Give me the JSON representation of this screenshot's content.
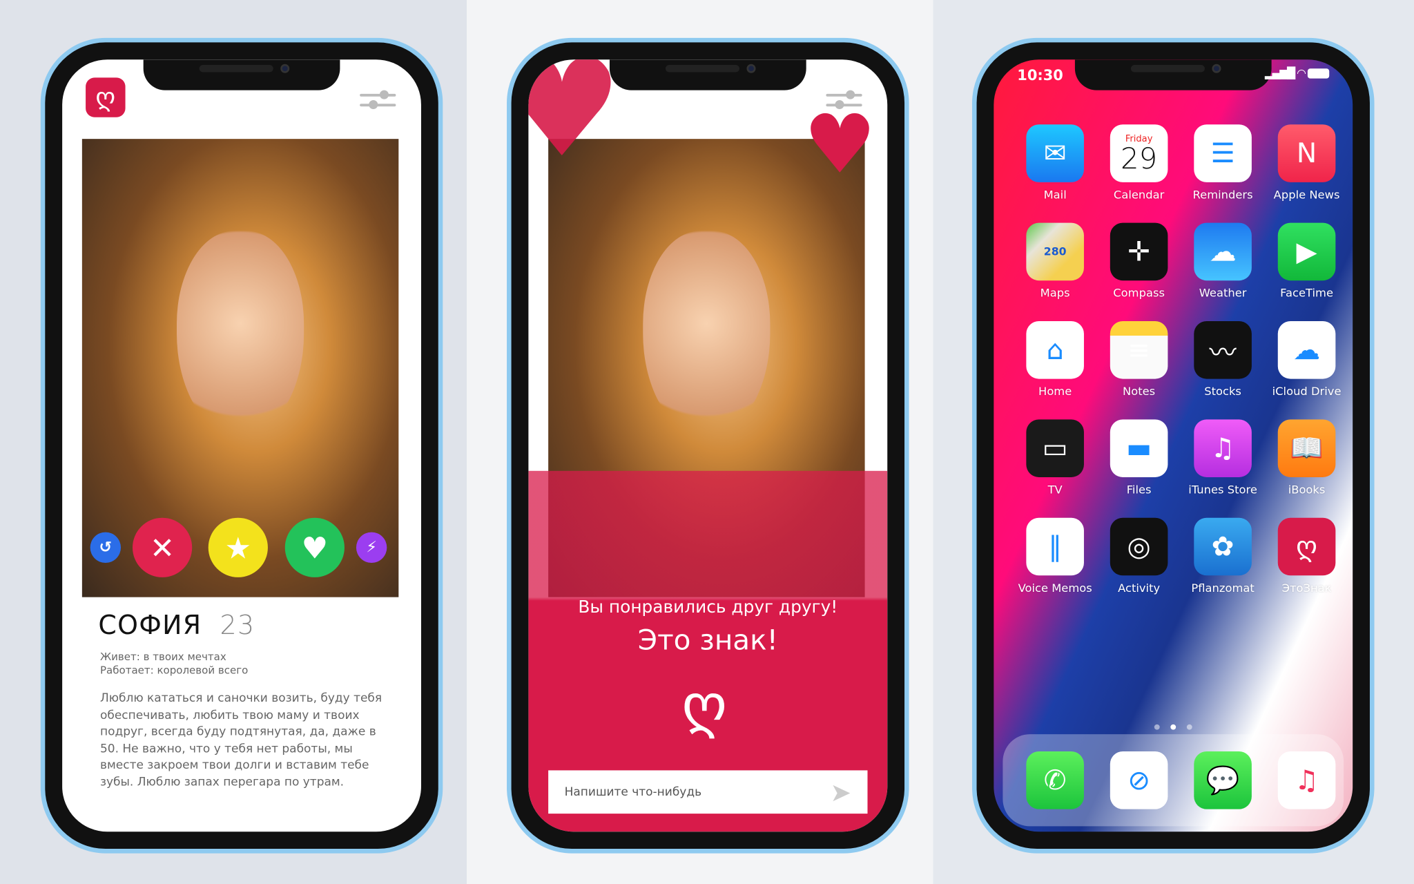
{
  "profile_screen": {
    "logo_icon": "heart-logo-icon",
    "filter_icon": "sliders-icon",
    "name": "СОФИЯ",
    "age": "23",
    "lives": "Живет: в твоих мечтах",
    "works": "Работает: королевой всего",
    "bio": "Люблю кататься и саночки возить, буду тебя обеспечивать, любить твою маму и твоих подруг, всегда буду подтянутая, да, даже в 50. Не важно, что у тебя нет работы, мы вместе закроем твои долги и вставим тебе зубы. Люблю запах перегара по утрам.",
    "actions": [
      {
        "icon": "rewind-icon",
        "glyph": "↺",
        "color": "#2b6de8"
      },
      {
        "icon": "close-icon",
        "glyph": "✕",
        "color": "#e0234e"
      },
      {
        "icon": "star-icon",
        "glyph": "★",
        "color": "#f3e21c"
      },
      {
        "icon": "heart-icon",
        "glyph": "♥",
        "color": "#23c25a"
      },
      {
        "icon": "boost-icon",
        "glyph": "⚡",
        "color": "#9b3ef0"
      }
    ]
  },
  "match_screen": {
    "title": "Вы понравились друг другу!",
    "subtitle": "Это знак!",
    "message_placeholder": "Напишите что-нибудь",
    "accent": "#d81b4a"
  },
  "home_screen": {
    "time": "10:30",
    "signal": "▂▄▆█",
    "calendar_day": "Friday",
    "calendar_date": "29",
    "apps": [
      {
        "label": "Mail",
        "glyph": "✉",
        "bg": "linear-gradient(#1ec8ff,#1a78f0)"
      },
      {
        "label": "Calendar",
        "glyph": "",
        "bg": "#ffffff"
      },
      {
        "label": "Reminders",
        "glyph": "☰",
        "bg": "#ffffff"
      },
      {
        "label": "Apple News",
        "glyph": "N",
        "bg": "linear-gradient(#ff5b6b,#f0244a)"
      },
      {
        "label": "Maps",
        "glyph": "280",
        "bg": "linear-gradient(135deg,#5cc84a 0,#e8e4d8 30%,#f5d050 70%)"
      },
      {
        "label": "Compass",
        "glyph": "✛",
        "bg": "#111111"
      },
      {
        "label": "Weather",
        "glyph": "☁",
        "bg": "linear-gradient(#1e7af0,#46c4ff)"
      },
      {
        "label": "FaceTime",
        "glyph": "▶",
        "bg": "linear-gradient(#30e060,#12b83a)"
      },
      {
        "label": "Home",
        "glyph": "⌂",
        "bg": "#ffffff"
      },
      {
        "label": "Notes",
        "glyph": "≡",
        "bg": "linear-gradient(#ffd23a 0,#ffd23a 25%,#fafafa 25%)"
      },
      {
        "label": "Stocks",
        "glyph": "〰",
        "bg": "#111111"
      },
      {
        "label": "iCloud Drive",
        "glyph": "☁",
        "bg": "#ffffff"
      },
      {
        "label": "TV",
        "glyph": "▭",
        "bg": "#1a1a1a"
      },
      {
        "label": "Files",
        "glyph": "▬",
        "bg": "#ffffff"
      },
      {
        "label": "iTunes Store",
        "glyph": "♫",
        "bg": "linear-gradient(#f05cf8,#b52ee0)"
      },
      {
        "label": "iBooks",
        "glyph": "📖",
        "bg": "linear-gradient(#ffa530,#ff7a10)"
      },
      {
        "label": "Voice Memos",
        "glyph": "‖",
        "bg": "#ffffff"
      },
      {
        "label": "Activity",
        "glyph": "◎",
        "bg": "#111111"
      },
      {
        "label": "Pflanzomat",
        "glyph": "✿",
        "bg": "linear-gradient(#3aaaf0,#1a70d0)"
      },
      {
        "label": "ЭтоЗнак",
        "glyph": "ღ",
        "bg": "#d81b4a"
      }
    ],
    "dock": [
      {
        "icon": "phone-icon",
        "glyph": "✆",
        "bg": "linear-gradient(#5cf05c,#1cc43c)"
      },
      {
        "icon": "safari-icon",
        "glyph": "⊘",
        "bg": "#ffffff"
      },
      {
        "icon": "messages-icon",
        "glyph": "💬",
        "bg": "linear-gradient(#5cf05c,#1cc43c)"
      },
      {
        "icon": "music-icon",
        "glyph": "♫",
        "bg": "#ffffff"
      }
    ]
  }
}
